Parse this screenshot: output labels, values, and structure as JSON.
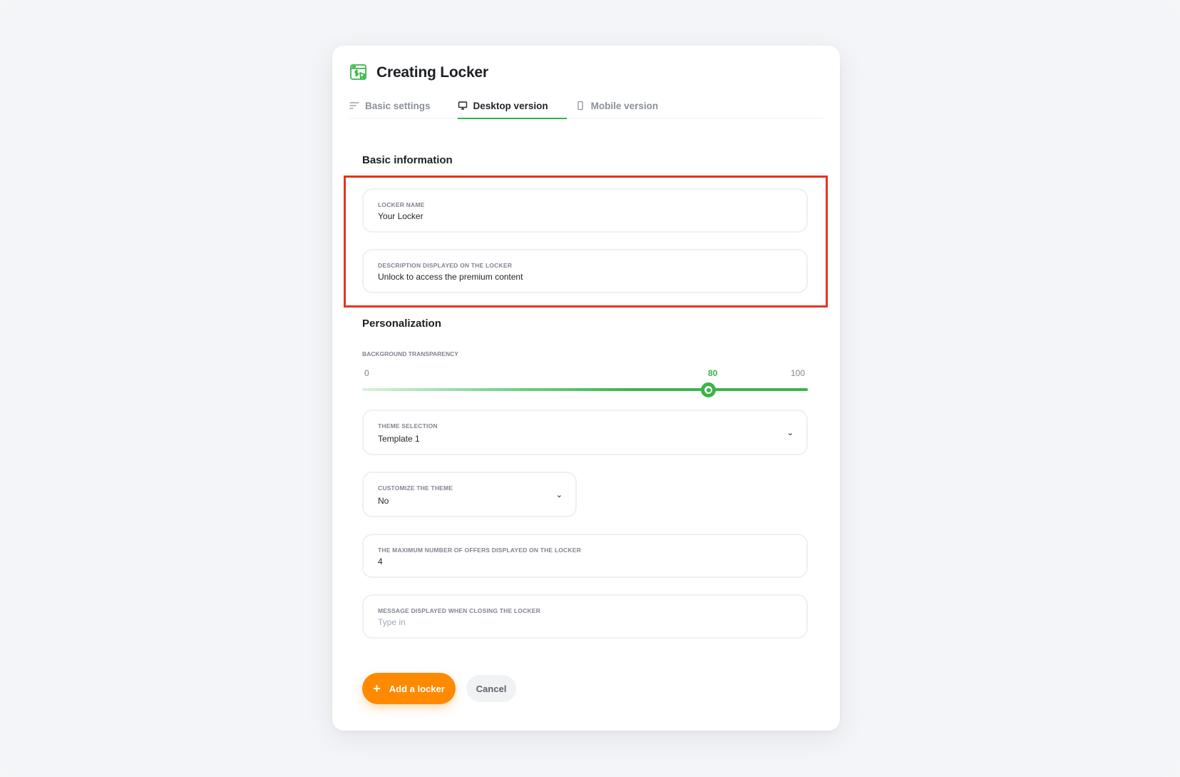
{
  "modal": {
    "title": "Creating Locker"
  },
  "tabs": [
    {
      "label": "Basic settings",
      "icon": "sliders-icon",
      "active": false
    },
    {
      "label": "Desktop version",
      "icon": "monitor-icon",
      "active": true
    },
    {
      "label": "Mobile version",
      "icon": "phone-icon",
      "active": false
    }
  ],
  "basic_info": {
    "title": "Basic information",
    "locker_name": {
      "label": "LOCKER NAME",
      "value": "Your Locker"
    },
    "description": {
      "label": "DESCRIPTION DISPLAYED ON THE LOCKER",
      "value": "Unlock to access the premium content"
    }
  },
  "personalization": {
    "title": "Personalization",
    "transparency": {
      "label": "BACKGROUND TRANSPARENCY",
      "min": "0",
      "max": "100",
      "value": "80",
      "value_fraction": 0.8
    },
    "theme": {
      "label": "THEME SELECTION",
      "value": "Template 1"
    },
    "customize": {
      "label": "CUSTOMIZE THE THEME",
      "value": "No"
    },
    "max_offers": {
      "label": "THE MAXIMUM NUMBER OF OFFERS DISPLAYED ON THE LOCKER",
      "value": "4"
    },
    "closing_message": {
      "label": "MESSAGE DISPLAYED WHEN CLOSING THE LOCKER",
      "placeholder": "Type in"
    }
  },
  "actions": {
    "add_label": "Add a locker",
    "add_icon": "+",
    "cancel_label": "Cancel"
  },
  "colors": {
    "accent_green": "#3bb54a",
    "primary_orange": "#ff8a00",
    "highlight_red": "#e8321e"
  }
}
